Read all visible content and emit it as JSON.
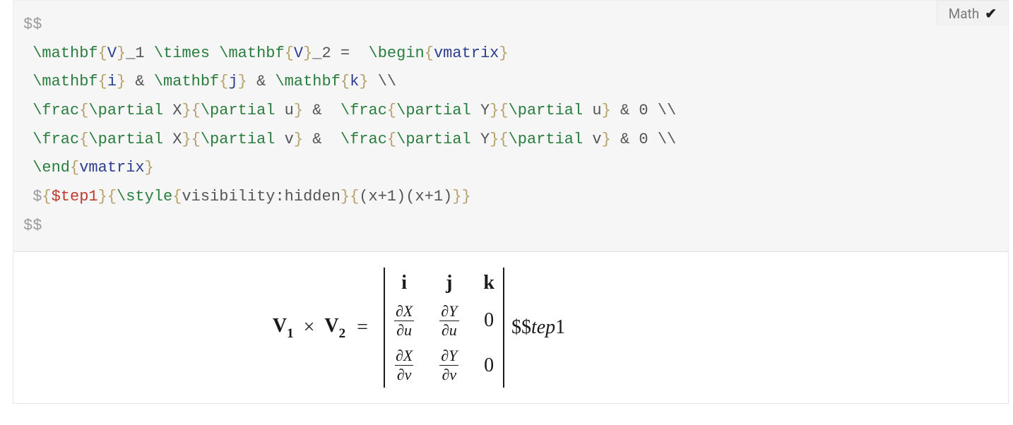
{
  "badge": {
    "label": "Math",
    "check_glyph": "✔"
  },
  "code": {
    "open_delim": "$$",
    "line2": {
      "mathbf": "\\mathbf",
      "V": "V",
      "us1": "_1 ",
      "times": "\\times",
      "sp1": " ",
      "mathbf2": "\\mathbf",
      "V2": "V",
      "us2": "_2 =  ",
      "begin": "\\begin",
      "vmatrix": "vmatrix"
    },
    "line3": {
      "mathbf_i": "\\mathbf",
      "i": "i",
      "amp1": " & ",
      "mathbf_j": "\\mathbf",
      "j": "j",
      "amp2": " & ",
      "mathbf_k": "\\mathbf",
      "k": "k",
      "bs": " \\\\"
    },
    "line4": {
      "frac1": "\\frac",
      "p1a": "\\partial",
      "X1": " X",
      "p1b": "\\partial",
      "u1": " u",
      "amp1": " &  ",
      "frac2": "\\frac",
      "p2a": "\\partial",
      "Y1": " Y",
      "p2b": "\\partial",
      "u2": " u",
      "amp2": " & 0 ",
      "bs": "\\\\"
    },
    "line5": {
      "frac1": "\\frac",
      "p1a": "\\partial",
      "X1": " X",
      "p1b": "\\partial",
      "v1": " v",
      "amp1": " &  ",
      "frac2": "\\frac",
      "p2a": "\\partial",
      "Y1": " Y",
      "p2b": "\\partial",
      "v2": " v",
      "amp2": " & 0 ",
      "bs": "\\\\"
    },
    "line6": {
      "end": "\\end",
      "vmatrix": "vmatrix"
    },
    "line7": {
      "d1": "$",
      "lb1": "{",
      "tpl": "$tep1",
      "rb1": "}",
      "lb2": "{",
      "style": "\\style",
      "lb3": "{",
      "vis": "visibility:hidden",
      "rb3": "}",
      "lb4": "{",
      "expr": "(x+1)(x+1)",
      "rb4": "}",
      "rb2": "}"
    },
    "close_delim": "$$"
  },
  "render": {
    "V": "V",
    "s1": "1",
    "s2": "2",
    "times": "×",
    "eq": "=",
    "i": "i",
    "j": "j",
    "k": "k",
    "dX": "∂X",
    "dY": "∂Y",
    "du": "∂u",
    "dv": "∂v",
    "zero": "0",
    "tep_dd": "$$",
    "tep_text": "tep",
    "tep_one": "1"
  }
}
